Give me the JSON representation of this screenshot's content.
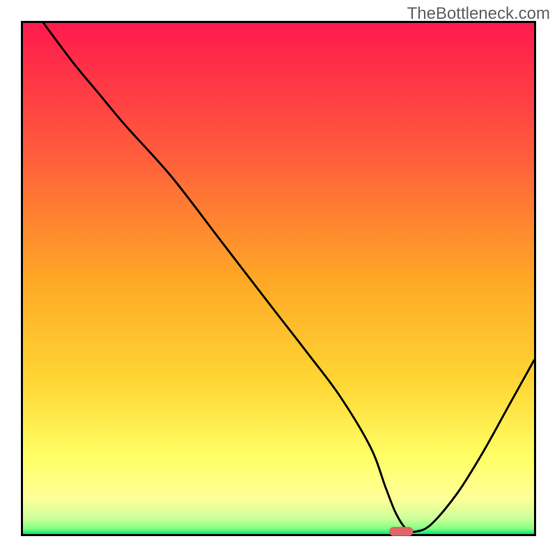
{
  "watermark": "TheBottleneck.com",
  "chart_data": {
    "type": "line",
    "title": "",
    "xlabel": "",
    "ylabel": "",
    "xlim": [
      0,
      100
    ],
    "ylim": [
      0,
      100
    ],
    "x": [
      4,
      10,
      15,
      20,
      29,
      39,
      49,
      56,
      62,
      68,
      71,
      73,
      75,
      77,
      80,
      85,
      90,
      95,
      100
    ],
    "values": [
      100,
      92,
      86,
      80,
      70,
      57,
      44,
      35,
      27,
      17,
      9,
      4,
      1,
      0.5,
      2,
      8,
      16,
      25,
      34
    ],
    "flat_region": {
      "x_start": 71,
      "x_end": 77,
      "y": 0.5
    },
    "marker": {
      "x": 74,
      "y": 0.5,
      "color": "#dd6666"
    },
    "gradient_stops": [
      {
        "offset": 0,
        "color": "#ff1a4d"
      },
      {
        "offset": 0.25,
        "color": "#ff5a3d"
      },
      {
        "offset": 0.5,
        "color": "#ffa726"
      },
      {
        "offset": 0.7,
        "color": "#ffd633"
      },
      {
        "offset": 0.85,
        "color": "#ffff66"
      },
      {
        "offset": 0.93,
        "color": "#ffff99"
      },
      {
        "offset": 0.97,
        "color": "#ccff99"
      },
      {
        "offset": 0.99,
        "color": "#80ff80"
      },
      {
        "offset": 1,
        "color": "#00e673"
      }
    ],
    "frame_color": "#000000",
    "frame_width": 3,
    "curve_color": "#000000",
    "curve_width": 3
  }
}
